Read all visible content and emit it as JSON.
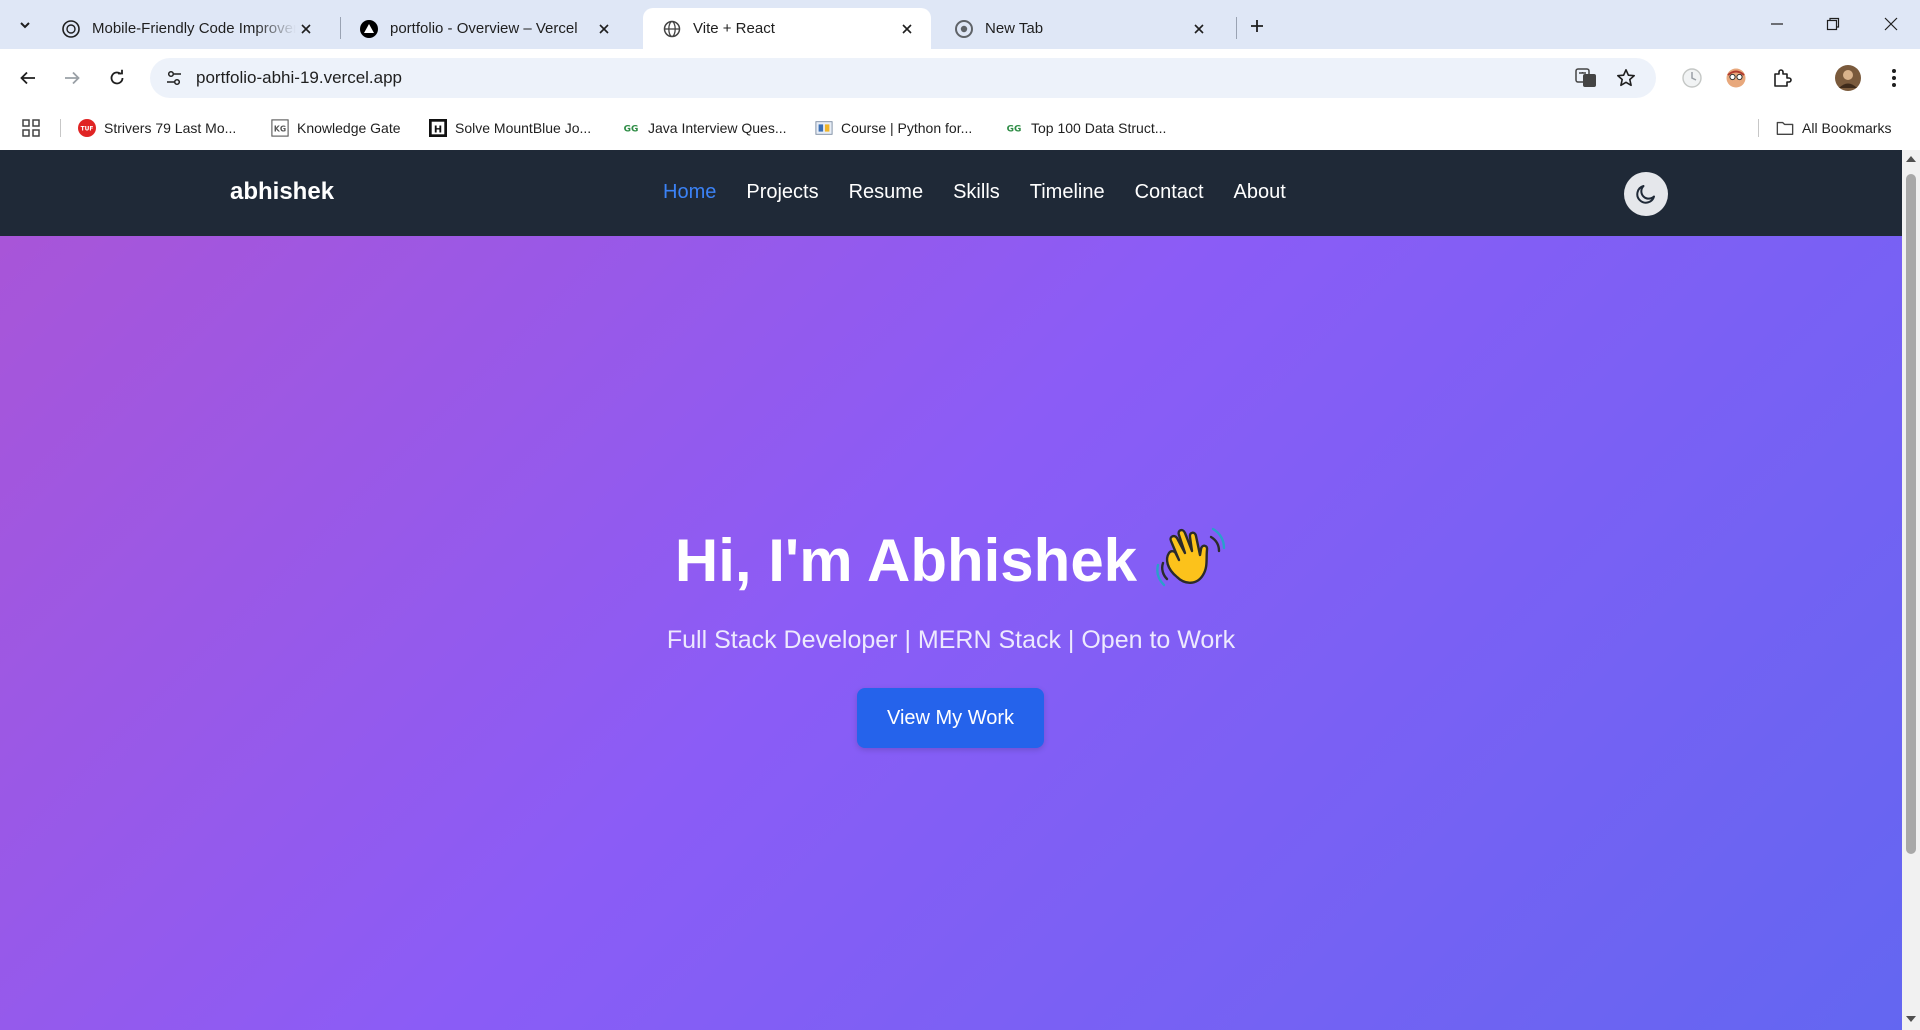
{
  "browser": {
    "tabs": [
      {
        "title": "Mobile-Friendly Code Improver",
        "icon": "openai-icon",
        "active": false
      },
      {
        "title": "portfolio - Overview – Vercel",
        "icon": "vercel-triangle-icon",
        "active": false
      },
      {
        "title": "Vite + React",
        "icon": "globe-icon",
        "active": true
      },
      {
        "title": "New Tab",
        "icon": "chrome-icon",
        "active": false
      }
    ],
    "url": "portfolio-abhi-19.vercel.app",
    "bookmarks": [
      {
        "label": "Strivers 79 Last Mo...",
        "icon": "tuf-icon",
        "icon_text": "TUF"
      },
      {
        "label": "Knowledge Gate",
        "icon": "kg-icon",
        "icon_text": "KG"
      },
      {
        "label": "Solve MountBlue Jo...",
        "icon": "hackerrank-icon",
        "icon_text": "H"
      },
      {
        "label": "Java Interview Ques...",
        "icon": "gfg-icon",
        "icon_text": "GG"
      },
      {
        "label": "Course | Python for...",
        "icon": "course-icon",
        "icon_text": ""
      },
      {
        "label": "Top 100 Data Struct...",
        "icon": "gfg-icon",
        "icon_text": "GG"
      }
    ],
    "all_bookmarks_label": "All Bookmarks"
  },
  "site": {
    "brand": "abhishek",
    "nav": [
      "Home",
      "Projects",
      "Resume",
      "Skills",
      "Timeline",
      "Contact",
      "About"
    ],
    "active_nav": "Home",
    "hero": {
      "title": "Hi, I'm Abhishek",
      "subtitle": "Full Stack Developer | MERN Stack | Open to Work",
      "cta_label": "View My Work"
    }
  },
  "colors": {
    "navbar_bg": "#1f2937",
    "nav_active": "#3b82f6",
    "hero_gradient_start": "#a855d8",
    "hero_gradient_end": "#6366f1",
    "cta_bg": "#2563eb",
    "tabstrip_bg": "#dfe7f6"
  }
}
